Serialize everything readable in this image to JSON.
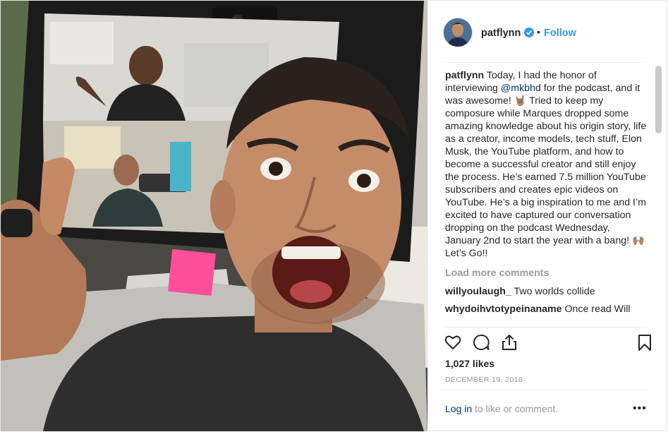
{
  "post": {
    "username": "patflynn",
    "follow_label": "Follow",
    "separator": "•",
    "caption": {
      "username": "patflynn",
      "text_before": " Today, I had the honor of interviewing ",
      "mention": "@mkbhd",
      "text_after": " for the podcast, and it was awesome! 🤘🏽 Tried to keep my composure while Marques dropped some amazing knowledge about his origin story, life as a creator, income models, tech stuff, Elon Musk, the YouTube platform, and how to become a successful creator and still enjoy the process. He’s earned 7.5 million YouTube subscribers and creates epic videos on YouTube. He’s a big inspiration to me and I’m excited to have captured our conversation dropping on the podcast Wednesday, January 2nd to start the year with a bang! 🙌🏽 Let’s Go!!"
    },
    "load_more_label": "Load more comments",
    "comments": [
      {
        "user": "willyoulaugh_",
        "text": " Two worlds collide"
      },
      {
        "user": "whydoihvtotypeinaname",
        "text": " Once read Will"
      }
    ],
    "likes": "1,027 likes",
    "date": "DECEMBER 19, 2018",
    "login": {
      "link": "Log in",
      "rest": " to like or comment."
    },
    "more_label": "•••",
    "icons": {
      "like": "heart-icon",
      "comment": "comment-bubble-icon",
      "share": "share-icon",
      "save": "bookmark-icon",
      "verified": "verified-badge-icon"
    },
    "colors": {
      "follow": "#3897f0",
      "mention": "#003569",
      "muted": "#999999",
      "text": "#262626"
    }
  }
}
